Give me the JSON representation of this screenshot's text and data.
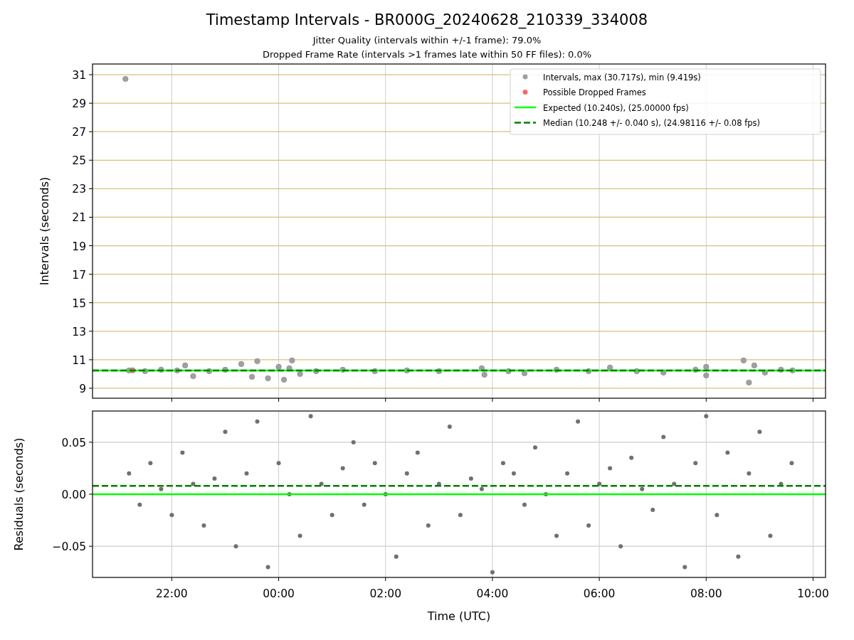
{
  "title": "Timestamp Intervals - BR000G_20240628_210339_334008",
  "subtitles": [
    "Jitter Quality (intervals within +/-1 frame): 79.0%",
    "Dropped Frame Rate (intervals >1 frames late within 50 FF files): 0.0%"
  ],
  "charts": [
    {
      "chart_data": {
        "type": "scatter",
        "ylabel": "Intervals (seconds)",
        "grid": true,
        "legend": true,
        "xlim": [
          "2024-06-28 20:31",
          "2024-06-29 10:14"
        ],
        "ylim": [
          8.3,
          31.75
        ],
        "yticks": [
          9,
          11,
          13,
          15,
          17,
          19,
          21,
          23,
          25,
          27,
          29,
          31
        ],
        "series": [
          {
            "name": "Intervals, max (30.717s), min (9.419s)",
            "type": "scatter",
            "color": "#a0a0a0",
            "x": [
              "2024-06-28 21:08",
              "2024-06-28 21:12",
              "2024-06-28 21:30",
              "2024-06-28 21:48",
              "2024-06-28 22:06",
              "2024-06-28 22:15",
              "2024-06-28 22:24",
              "2024-06-28 22:42",
              "2024-06-28 23:00",
              "2024-06-28 23:18",
              "2024-06-28 23:30",
              "2024-06-28 23:36",
              "2024-06-28 23:48",
              "2024-06-29 00:00",
              "2024-06-29 00:06",
              "2024-06-29 00:12",
              "2024-06-29 00:15",
              "2024-06-29 00:24",
              "2024-06-29 00:42",
              "2024-06-29 01:12",
              "2024-06-29 01:48",
              "2024-06-29 02:24",
              "2024-06-29 03:00",
              "2024-06-29 03:48",
              "2024-06-29 03:51",
              "2024-06-29 04:18",
              "2024-06-29 04:36",
              "2024-06-29 05:12",
              "2024-06-29 05:48",
              "2024-06-29 06:12",
              "2024-06-29 06:42",
              "2024-06-29 07:12",
              "2024-06-29 07:48",
              "2024-06-29 08:00",
              "2024-06-29 08:00",
              "2024-06-29 08:42",
              "2024-06-29 08:48",
              "2024-06-29 08:54",
              "2024-06-29 09:06",
              "2024-06-29 09:24",
              "2024-06-29 09:37"
            ],
            "values": [
              30.7,
              10.25,
              10.2,
              10.3,
              10.25,
              10.6,
              9.85,
              10.2,
              10.3,
              10.7,
              9.8,
              10.9,
              9.7,
              10.5,
              9.6,
              10.4,
              10.95,
              10.0,
              10.2,
              10.3,
              10.2,
              10.25,
              10.2,
              10.4,
              9.95,
              10.2,
              10.05,
              10.3,
              10.2,
              10.45,
              10.2,
              10.1,
              10.3,
              10.5,
              9.9,
              10.95,
              9.4,
              10.6,
              10.1,
              10.3,
              10.25
            ]
          },
          {
            "name": "Possible Dropped Frames",
            "type": "scatter",
            "color": "#ff6666",
            "x": [
              "2024-06-28 21:16"
            ],
            "values": [
              10.26
            ]
          },
          {
            "name": "Expected (10.240s), (25.00000 fps)",
            "type": "line",
            "line_style": "solid",
            "color": "#00ff00",
            "x": [
              "2024-06-28 20:31",
              "2024-06-29 10:14"
            ],
            "values": [
              10.24,
              10.24
            ]
          },
          {
            "name": "Median (10.248 +/- 0.040 s), (24.98116 +/- 0.08 fps)",
            "type": "line",
            "line_style": "dashed",
            "color": "#008000",
            "x": [
              "2024-06-28 20:31",
              "2024-06-29 10:14"
            ],
            "values": [
              10.25,
              10.25
            ]
          }
        ]
      }
    },
    {
      "chart_data": {
        "type": "scatter",
        "xlabel": "Time (UTC)",
        "ylabel": "Residuals (seconds)",
        "grid": true,
        "xlim": [
          "2024-06-28 20:31",
          "2024-06-29 10:14"
        ],
        "ylim": [
          -0.08,
          0.08
        ],
        "xticks": [
          {
            "value": "2024-06-28 22:00",
            "label": "22:00"
          },
          {
            "value": "2024-06-29 00:00",
            "label": "00:00"
          },
          {
            "value": "2024-06-29 02:00",
            "label": "02:00"
          },
          {
            "value": "2024-06-29 04:00",
            "label": "04:00"
          },
          {
            "value": "2024-06-29 06:00",
            "label": "06:00"
          },
          {
            "value": "2024-06-29 08:00",
            "label": "08:00"
          },
          {
            "value": "2024-06-29 10:00",
            "label": "10:00"
          }
        ],
        "yticks": [
          {
            "value": -0.05,
            "label": "−0.05"
          },
          {
            "value": 0,
            "label": "0.00"
          },
          {
            "value": 0.05,
            "label": "0.05"
          }
        ],
        "series": [
          {
            "type": "scatter",
            "color": "#707070",
            "x": [
              "2024-06-28 21:12",
              "2024-06-28 21:24",
              "2024-06-28 21:36",
              "2024-06-28 21:48",
              "2024-06-28 22:00",
              "2024-06-28 22:12",
              "2024-06-28 22:24",
              "2024-06-28 22:36",
              "2024-06-28 22:48",
              "2024-06-28 23:00",
              "2024-06-28 23:12",
              "2024-06-28 23:24",
              "2024-06-28 23:36",
              "2024-06-28 23:48",
              "2024-06-29 00:00",
              "2024-06-29 00:12",
              "2024-06-29 00:24",
              "2024-06-29 00:36",
              "2024-06-29 00:48",
              "2024-06-29 01:00",
              "2024-06-29 01:12",
              "2024-06-29 01:24",
              "2024-06-29 01:36",
              "2024-06-29 01:48",
              "2024-06-29 02:00",
              "2024-06-29 02:12",
              "2024-06-29 02:24",
              "2024-06-29 02:36",
              "2024-06-29 02:48",
              "2024-06-29 03:00",
              "2024-06-29 03:12",
              "2024-06-29 03:24",
              "2024-06-29 03:36",
              "2024-06-29 03:48",
              "2024-06-29 04:00",
              "2024-06-29 04:12",
              "2024-06-29 04:24",
              "2024-06-29 04:36",
              "2024-06-29 04:48",
              "2024-06-29 05:00",
              "2024-06-29 05:12",
              "2024-06-29 05:24",
              "2024-06-29 05:36",
              "2024-06-29 05:48",
              "2024-06-29 06:00",
              "2024-06-29 06:12",
              "2024-06-29 06:24",
              "2024-06-29 06:36",
              "2024-06-29 06:48",
              "2024-06-29 07:00",
              "2024-06-29 07:12",
              "2024-06-29 07:24",
              "2024-06-29 07:36",
              "2024-06-29 07:48",
              "2024-06-29 08:00",
              "2024-06-29 08:12",
              "2024-06-29 08:24",
              "2024-06-29 08:36",
              "2024-06-29 08:48",
              "2024-06-29 09:00",
              "2024-06-29 09:12",
              "2024-06-29 09:24",
              "2024-06-29 09:36"
            ],
            "values": [
              0.02,
              -0.01,
              0.03,
              0.005,
              -0.02,
              0.04,
              0.01,
              -0.03,
              0.015,
              0.06,
              -0.05,
              0.02,
              0.07,
              -0.07,
              0.03,
              0.0,
              -0.04,
              0.075,
              0.01,
              -0.02,
              0.025,
              0.05,
              -0.01,
              0.03,
              0.0,
              -0.06,
              0.02,
              0.04,
              -0.03,
              0.01,
              0.065,
              -0.02,
              0.015,
              0.005,
              -0.075,
              0.03,
              0.02,
              -0.01,
              0.045,
              0.0,
              -0.04,
              0.02,
              0.07,
              -0.03,
              0.01,
              0.025,
              -0.05,
              0.035,
              0.005,
              -0.015,
              0.055,
              0.01,
              -0.07,
              0.03,
              0.075,
              -0.02,
              0.04,
              -0.06,
              0.02,
              0.06,
              -0.04,
              0.01,
              0.03
            ]
          },
          {
            "type": "line",
            "line_style": "dashed",
            "color": "#008000",
            "x": [
              "2024-06-28 20:31",
              "2024-06-29 10:14"
            ],
            "values": [
              0.008,
              0.008
            ]
          },
          {
            "type": "line",
            "line_style": "solid",
            "color": "#00ff00",
            "x": [
              "2024-06-28 20:31",
              "2024-06-29 10:14"
            ],
            "values": [
              0,
              0
            ]
          }
        ]
      }
    }
  ]
}
